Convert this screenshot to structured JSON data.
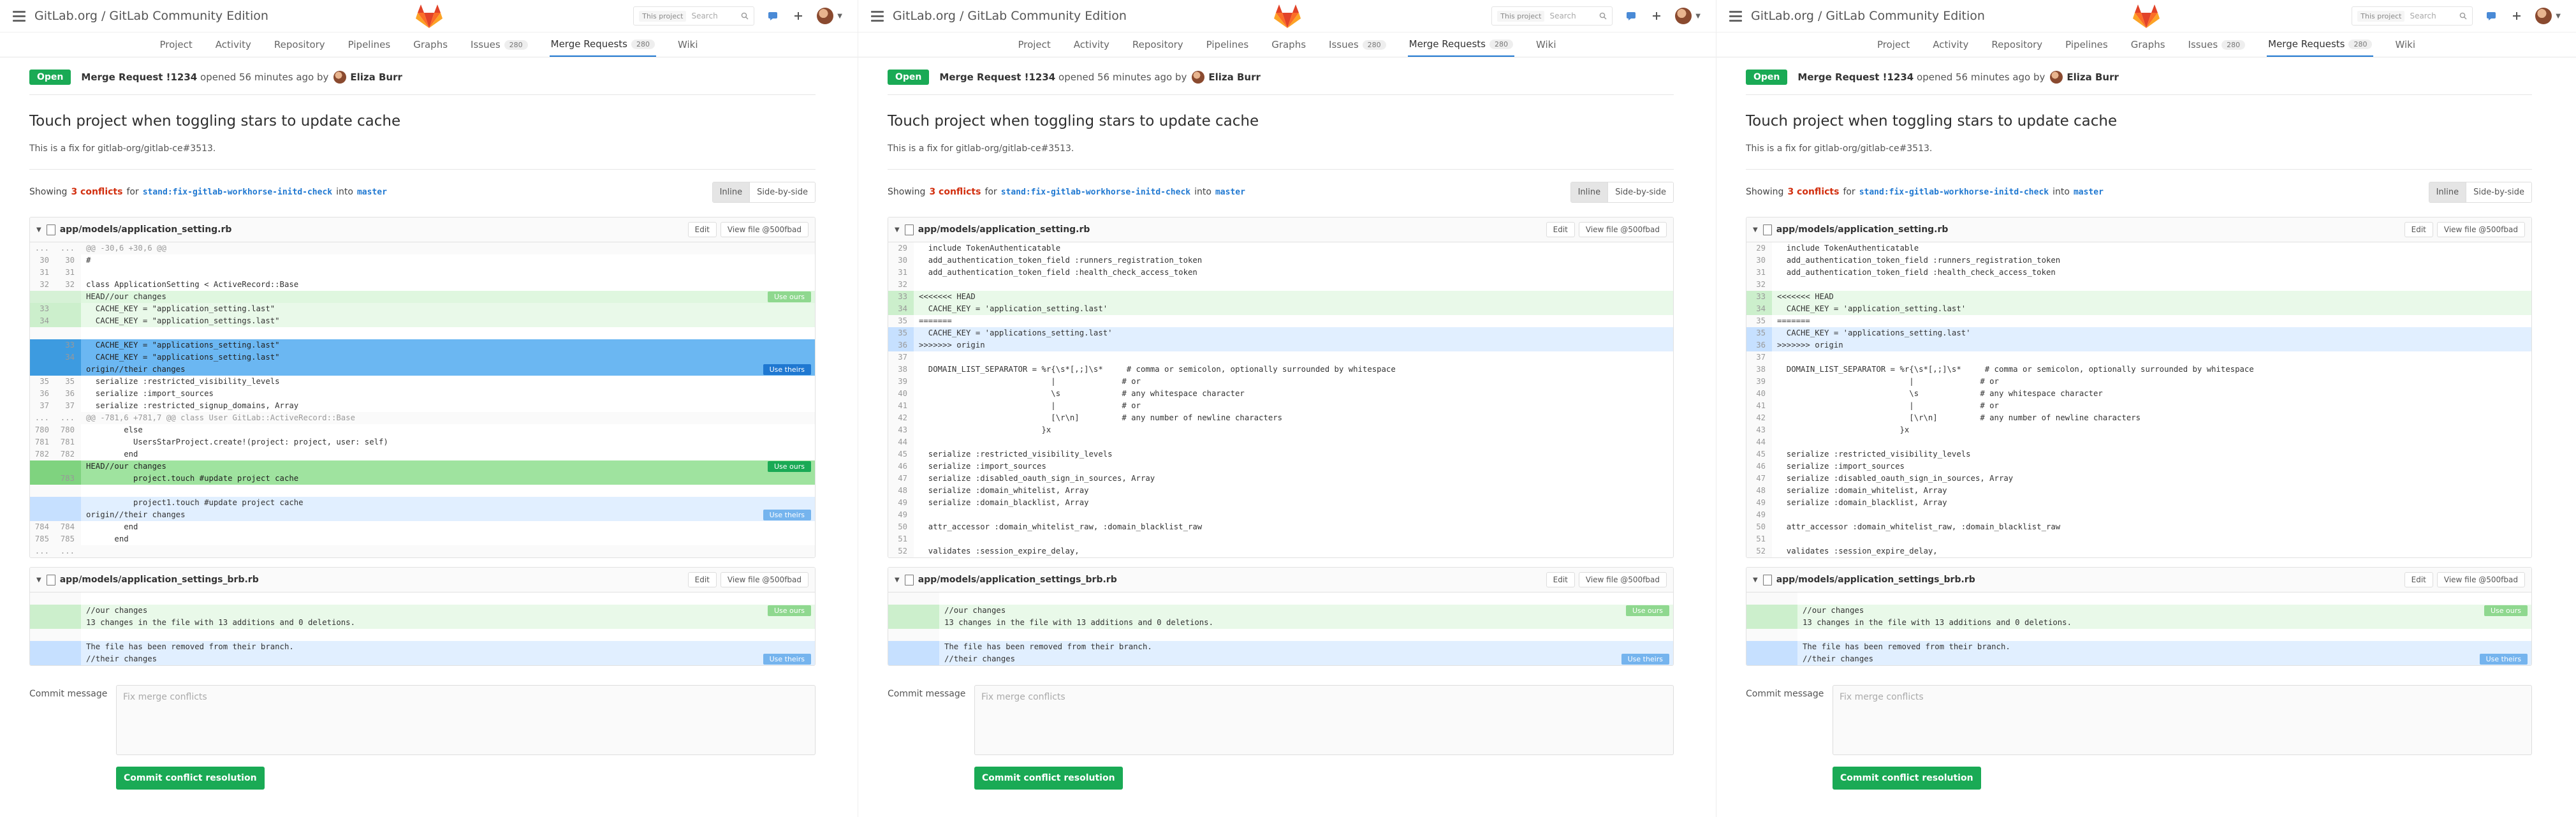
{
  "header": {
    "brand": "GitLab.org / GitLab Community Edition",
    "search_scope": "This project",
    "search_placeholder": "Search"
  },
  "nav": {
    "items": [
      "Project",
      "Activity",
      "Repository",
      "Pipelines",
      "Graphs",
      "Issues",
      "Merge Requests",
      "Wiki"
    ],
    "issues_count": "280",
    "mr_count": "280",
    "active": "Merge Requests"
  },
  "mr": {
    "status": "Open",
    "ref": "Merge Request !1234",
    "opened": "opened 56 minutes ago by",
    "author": "Eliza Burr",
    "title": "Touch project when toggling stars to update cache",
    "description": "This is a fix for gitlab-org/gitlab-ce#3513."
  },
  "showing": {
    "prefix": "Showing",
    "conflicts": "3 conflicts",
    "for": "for",
    "source_branch": "stand:fix-gitlab-workhorse-initd-check",
    "into": "into",
    "target_branch": "master",
    "inline": "Inline",
    "side_by_side": "Side-by-side"
  },
  "files": {
    "file1": "app/models/application_setting.rb",
    "file2": "app/models/application_settings_brb.rb",
    "edit": "Edit",
    "view": "View file @500fbad",
    "use_ours": "Use ours",
    "use_theirs": "Use theirs"
  },
  "panel1_file1": [
    {
      "t": "hunk",
      "o": "...",
      "n": "...",
      "c": "@@ -30,6 +30,6 @@"
    },
    {
      "t": "ctx",
      "o": "30",
      "n": "30",
      "c": "#"
    },
    {
      "t": "ctx",
      "o": "31",
      "n": "31",
      "c": ""
    },
    {
      "t": "ctx",
      "o": "32",
      "n": "32",
      "c": "class ApplicationSetting < ActiveRecord::Base"
    },
    {
      "t": "head-marker",
      "o": "",
      "n": "",
      "c": "HEAD//our changes",
      "btn": "ours"
    },
    {
      "t": "ours",
      "o": "33",
      "n": "",
      "c": "  CACHE_KEY = \"application_setting.last\""
    },
    {
      "t": "ours",
      "o": "34",
      "n": "",
      "c": "  CACHE_KEY = \"application_settings.last\""
    },
    {
      "t": "blank",
      "o": "",
      "n": "",
      "c": ""
    },
    {
      "t": "theirs-sel",
      "o": "",
      "n": "33",
      "c": "  CACHE_KEY = \"applications_setting.last\""
    },
    {
      "t": "theirs-sel",
      "o": "",
      "n": "34",
      "c": "  CACHE_KEY = \"applications_setting.last\""
    },
    {
      "t": "theirs-sel",
      "o": "",
      "n": "",
      "c": "origin//their changes",
      "btn": "theirs-strong"
    },
    {
      "t": "ctx",
      "o": "35",
      "n": "35",
      "c": "  serialize :restricted_visibility_levels"
    },
    {
      "t": "ctx",
      "o": "36",
      "n": "36",
      "c": "  serialize :import_sources"
    },
    {
      "t": "ctx",
      "o": "37",
      "n": "37",
      "c": "  serialize :restricted_signup_domains, Array"
    },
    {
      "t": "hunk",
      "o": "...",
      "n": "...",
      "c": "@@ -781,6 +781,7 @@ class User GitLab::ActiveRecord::Base"
    },
    {
      "t": "ctx",
      "o": "780",
      "n": "780",
      "c": "        else"
    },
    {
      "t": "ctx",
      "o": "781",
      "n": "781",
      "c": "          UsersStarProject.create!(project: project, user: self)"
    },
    {
      "t": "ctx",
      "o": "782",
      "n": "782",
      "c": "        end"
    },
    {
      "t": "ours-sel",
      "o": "",
      "n": "",
      "c": "HEAD//our changes",
      "btn": "ours-strong"
    },
    {
      "t": "ours-sel",
      "o": "",
      "n": "783",
      "c": "          project.touch #update project cache"
    },
    {
      "t": "blank",
      "o": "",
      "n": "",
      "c": ""
    },
    {
      "t": "theirs",
      "o": "",
      "n": "",
      "c": "          project1.touch #update project cache"
    },
    {
      "t": "theirs",
      "o": "",
      "n": "",
      "c": "origin//their changes",
      "btn": "theirs"
    },
    {
      "t": "ctx",
      "o": "784",
      "n": "784",
      "c": "        end"
    },
    {
      "t": "ctx",
      "o": "785",
      "n": "785",
      "c": "      end"
    },
    {
      "t": "hunk",
      "o": "...",
      "n": "...",
      "c": ""
    }
  ],
  "full_file1": [
    {
      "t": "ctx",
      "o": "29",
      "c": "  include TokenAuthenticatable"
    },
    {
      "t": "ctx",
      "o": "30",
      "c": "  add_authentication_token_field :runners_registration_token"
    },
    {
      "t": "ctx",
      "o": "31",
      "c": "  add_authentication_token_field :health_check_access_token"
    },
    {
      "t": "ctx",
      "o": "32",
      "c": ""
    },
    {
      "t": "ours",
      "o": "33",
      "c": "<<<<<<< HEAD"
    },
    {
      "t": "ours",
      "o": "34",
      "c": "  CACHE_KEY = 'application_setting.last'"
    },
    {
      "t": "ctx",
      "o": "35",
      "c": "======="
    },
    {
      "t": "theirs",
      "o": "35",
      "c": "  CACHE_KEY = 'applications_setting.last'"
    },
    {
      "t": "theirs",
      "o": "36",
      "c": ">>>>>>> origin"
    },
    {
      "t": "ctx",
      "o": "37",
      "c": ""
    },
    {
      "t": "ctx",
      "o": "38",
      "c": "  DOMAIN_LIST_SEPARATOR = %r{\\s*[,;]\\s*     # comma or semicolon, optionally surrounded by whitespace"
    },
    {
      "t": "ctx",
      "o": "39",
      "c": "                            |              # or"
    },
    {
      "t": "ctx",
      "o": "40",
      "c": "                            \\s             # any whitespace character"
    },
    {
      "t": "ctx",
      "o": "41",
      "c": "                            |              # or"
    },
    {
      "t": "ctx",
      "o": "42",
      "c": "                            [\\r\\n]         # any number of newline characters"
    },
    {
      "t": "ctx",
      "o": "43",
      "c": "                          }x"
    },
    {
      "t": "ctx",
      "o": "44",
      "c": ""
    },
    {
      "t": "ctx",
      "o": "45",
      "c": "  serialize :restricted_visibility_levels"
    },
    {
      "t": "ctx",
      "o": "46",
      "c": "  serialize :import_sources"
    },
    {
      "t": "ctx",
      "o": "47",
      "c": "  serialize :disabled_oauth_sign_in_sources, Array"
    },
    {
      "t": "ctx",
      "o": "48",
      "c": "  serialize :domain_whitelist, Array"
    },
    {
      "t": "ctx",
      "o": "49",
      "c": "  serialize :domain_blacklist, Array"
    },
    {
      "t": "ctx",
      "o": "49",
      "c": ""
    },
    {
      "t": "ctx",
      "o": "50",
      "c": "  attr_accessor :domain_whitelist_raw, :domain_blacklist_raw"
    },
    {
      "t": "ctx",
      "o": "51",
      "c": ""
    },
    {
      "t": "ctx",
      "o": "52",
      "c": "  validates :session_expire_delay,"
    }
  ],
  "file2_rows": [
    {
      "t": "blank",
      "o": "",
      "n": "",
      "c": ""
    },
    {
      "t": "ours",
      "o": "",
      "n": "",
      "c": "//our changes",
      "btn": "ours"
    },
    {
      "t": "ours",
      "o": "",
      "n": "",
      "c": "13 changes in the file with 13 additions and 0 deletions."
    },
    {
      "t": "blank",
      "o": "",
      "n": "",
      "c": ""
    },
    {
      "t": "theirs",
      "o": "",
      "n": "",
      "c": "The file has been removed from their branch."
    },
    {
      "t": "theirs",
      "o": "",
      "n": "",
      "c": "//their changes",
      "btn": "theirs"
    }
  ],
  "commit": {
    "label": "Commit message",
    "placeholder": "Fix merge conflicts",
    "button": "Commit conflict resolution"
  },
  "colors": {
    "accent": "#1f78d1",
    "success": "#1aaa55",
    "danger": "#d22f0f",
    "ours_bg": "#e9f9e9",
    "theirs_bg": "#e1efff"
  }
}
